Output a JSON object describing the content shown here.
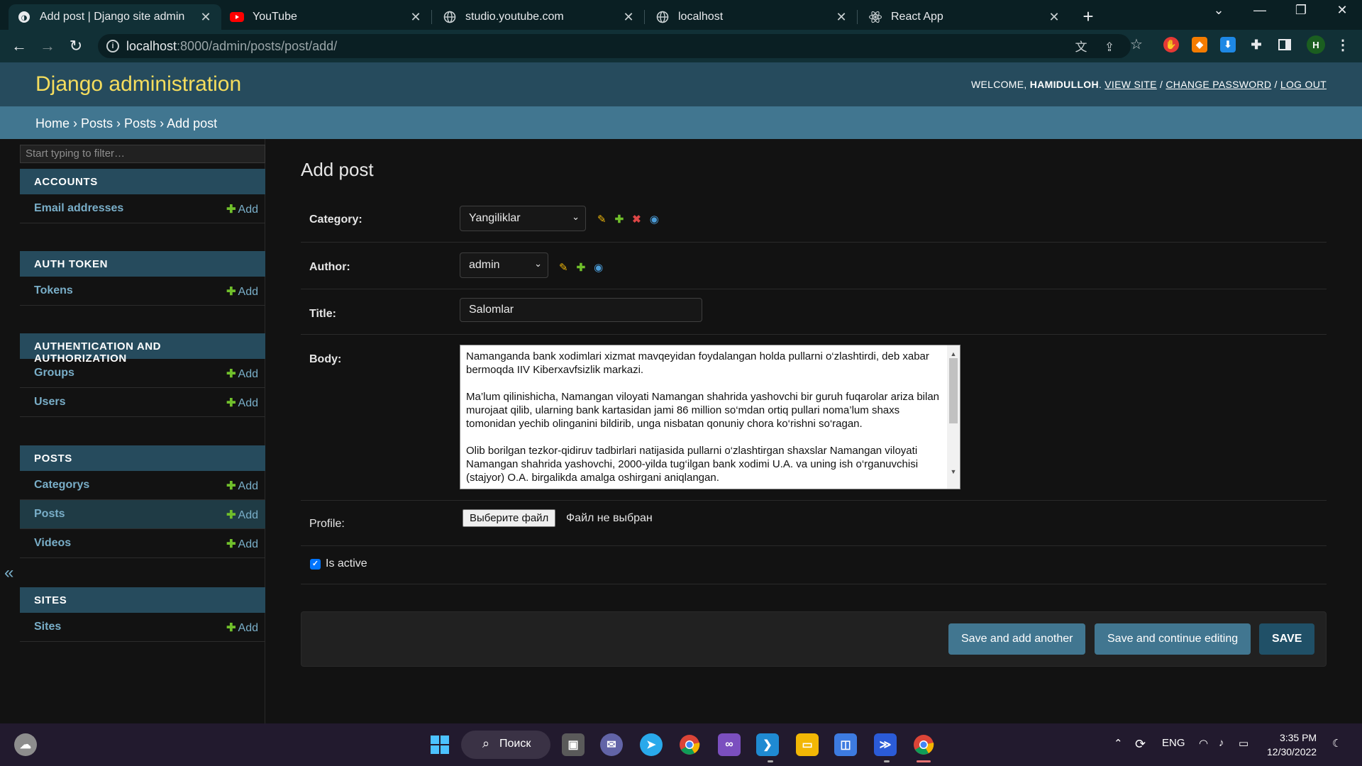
{
  "browser": {
    "tabs": [
      {
        "title": "Add post | Django site admin",
        "icon": "django-icon",
        "active": true
      },
      {
        "title": "YouTube",
        "icon": "youtube-icon"
      },
      {
        "title": "studio.youtube.com",
        "icon": "globe-icon"
      },
      {
        "title": "localhost",
        "icon": "globe-icon"
      },
      {
        "title": "React App",
        "icon": "react-icon"
      }
    ],
    "url_host": "localhost",
    "url_rest": ":8000/admin/posts/post/add/",
    "profile_initial": "H"
  },
  "header": {
    "brand": "Django administration",
    "welcome": "WELCOME,",
    "username": "HAMIDULLOH",
    "links": [
      "VIEW SITE",
      "CHANGE PASSWORD",
      "LOG OUT"
    ]
  },
  "breadcrumbs": [
    "Home",
    "Posts",
    "Posts",
    "Add post"
  ],
  "sidebar": {
    "filter_placeholder": "Start typing to filter…",
    "add_label": "Add",
    "collapse_glyph": "«",
    "modules": [
      {
        "caption": "ACCOUNTS",
        "items": [
          "Email addresses"
        ]
      },
      {
        "caption": "AUTH TOKEN",
        "items": [
          "Tokens"
        ]
      },
      {
        "caption": "AUTHENTICATION AND AUTHORIZATION",
        "items": [
          "Groups",
          "Users"
        ]
      },
      {
        "caption": "POSTS",
        "items": [
          "Categorys",
          "Posts",
          "Videos"
        ],
        "selected": "Posts"
      },
      {
        "caption": "SITES",
        "items": [
          "Sites"
        ]
      }
    ]
  },
  "form": {
    "title": "Add post",
    "category_label": "Category:",
    "category_value": "Yangiliklar",
    "author_label": "Author:",
    "author_value": "admin",
    "title_label": "Title:",
    "title_value": "Salomlar",
    "body_label": "Body:",
    "body_paragraphs": [
      "Namanganda bank xodimlari xizmat mavqeyidan foydalangan holda pullarni o‘zlashtirdi, deb xabar bermoqda IIV Kiberxavfsizlik markazi.",
      "Ma’lum qilinishicha, Namangan viloyati Namangan shahrida yashovchi bir guruh fuqarolar ariza bilan murojaat qilib, ularning bank kartasidan jami 86 million so‘mdan ortiq pullari noma’lum shaxs tomonidan yechib olinganini bildirib, unga nisbatan qonuniy chora ko‘rishni so‘ragan.",
      "Olib borilgan tezkor-qidiruv tadbirlari natijasida pullarni o‘zlashtirgan shaxslar Namangan viloyati Namangan shahrida yashovchi, 2000-yilda tug‘ilgan bank xodimi U.A. va uning ish o‘rganuvchisi (stajyor) O.A. birgalikda amalga oshirgani aniqlangan."
    ],
    "profile_label": "Profile:",
    "file_button": "Выберите файл",
    "file_none": "Файл не выбран",
    "is_active_label": "Is active",
    "is_active": true,
    "buttons": {
      "save_add_another": "Save and add another",
      "save_continue": "Save and continue editing",
      "save": "SAVE"
    }
  },
  "taskbar": {
    "search_label": "Поиск",
    "lang": "ENG",
    "time": "3:35 PM",
    "date": "12/30/2022"
  },
  "colors": {
    "header_bg": "#264b5d",
    "brand": "#f5dd5d",
    "breadcrumbs_bg": "#417690",
    "link": "#79aec8",
    "add_plus": "#70bf2b"
  }
}
